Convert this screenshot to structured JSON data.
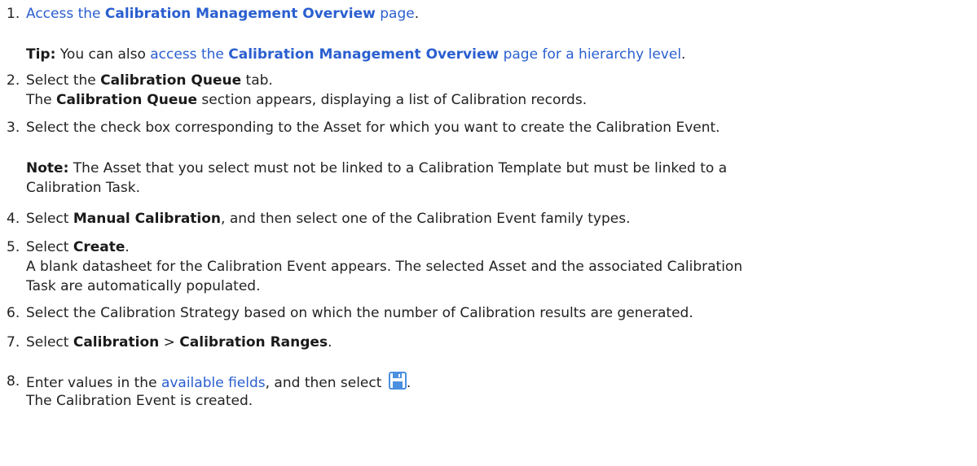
{
  "steps": [
    {
      "num": "1.",
      "link_pre": "Access the ",
      "link_bold": "Calibration Management Overview",
      "link_post": " page",
      "end": "."
    },
    {
      "num": "2.",
      "pre": "Select the ",
      "bold": "Calibration Queue",
      "post": " tab.",
      "result_bold": "Calibration Queue",
      "result_post": " section appears, displaying a list of Calibration records.",
      "result_pre": "The "
    },
    {
      "num": "3.",
      "text": "Select the check box corresponding to the Asset for which you want to create the Calibration Event."
    },
    {
      "num": "4.",
      "pre": "Select ",
      "bold": "Manual Calibration",
      "post": ", and then select one of the Calibration Event family types."
    },
    {
      "num": "5.",
      "pre": "Select ",
      "bold": "Create",
      "post": ".",
      "result_line1": "A blank datasheet for the Calibration Event appears. The selected Asset and the associated Calibration",
      "result_line2": "Task are automatically populated."
    },
    {
      "num": "6.",
      "text": "Select the Calibration Strategy based on which the number of Calibration results are generated."
    },
    {
      "num": "7.",
      "pre": "Select ",
      "bold1": "Calibration",
      "sep": " > ",
      "bold2": "Calibration Ranges",
      "post": "."
    },
    {
      "num": "8.",
      "pre": "Enter values in the ",
      "link": "available fields",
      "post": ", and then select ",
      "end": ".",
      "result": "The Calibration Event is created.",
      "icon": "save-icon"
    }
  ],
  "tip": {
    "label": "Tip:",
    "pre": " You can also ",
    "link_pre": "access the ",
    "link_bold": "Calibration Management Overview",
    "link_post": " page for a hierarchy level",
    "end": "."
  },
  "note": {
    "label": "Note:",
    "line1": " The Asset that you select must not be linked to a Calibration Template but must be linked to a",
    "line2": "Calibration Task."
  },
  "colors": {
    "link": "#2a5fd0",
    "text": "#222222",
    "icon_blue": "#4a8fe0"
  }
}
